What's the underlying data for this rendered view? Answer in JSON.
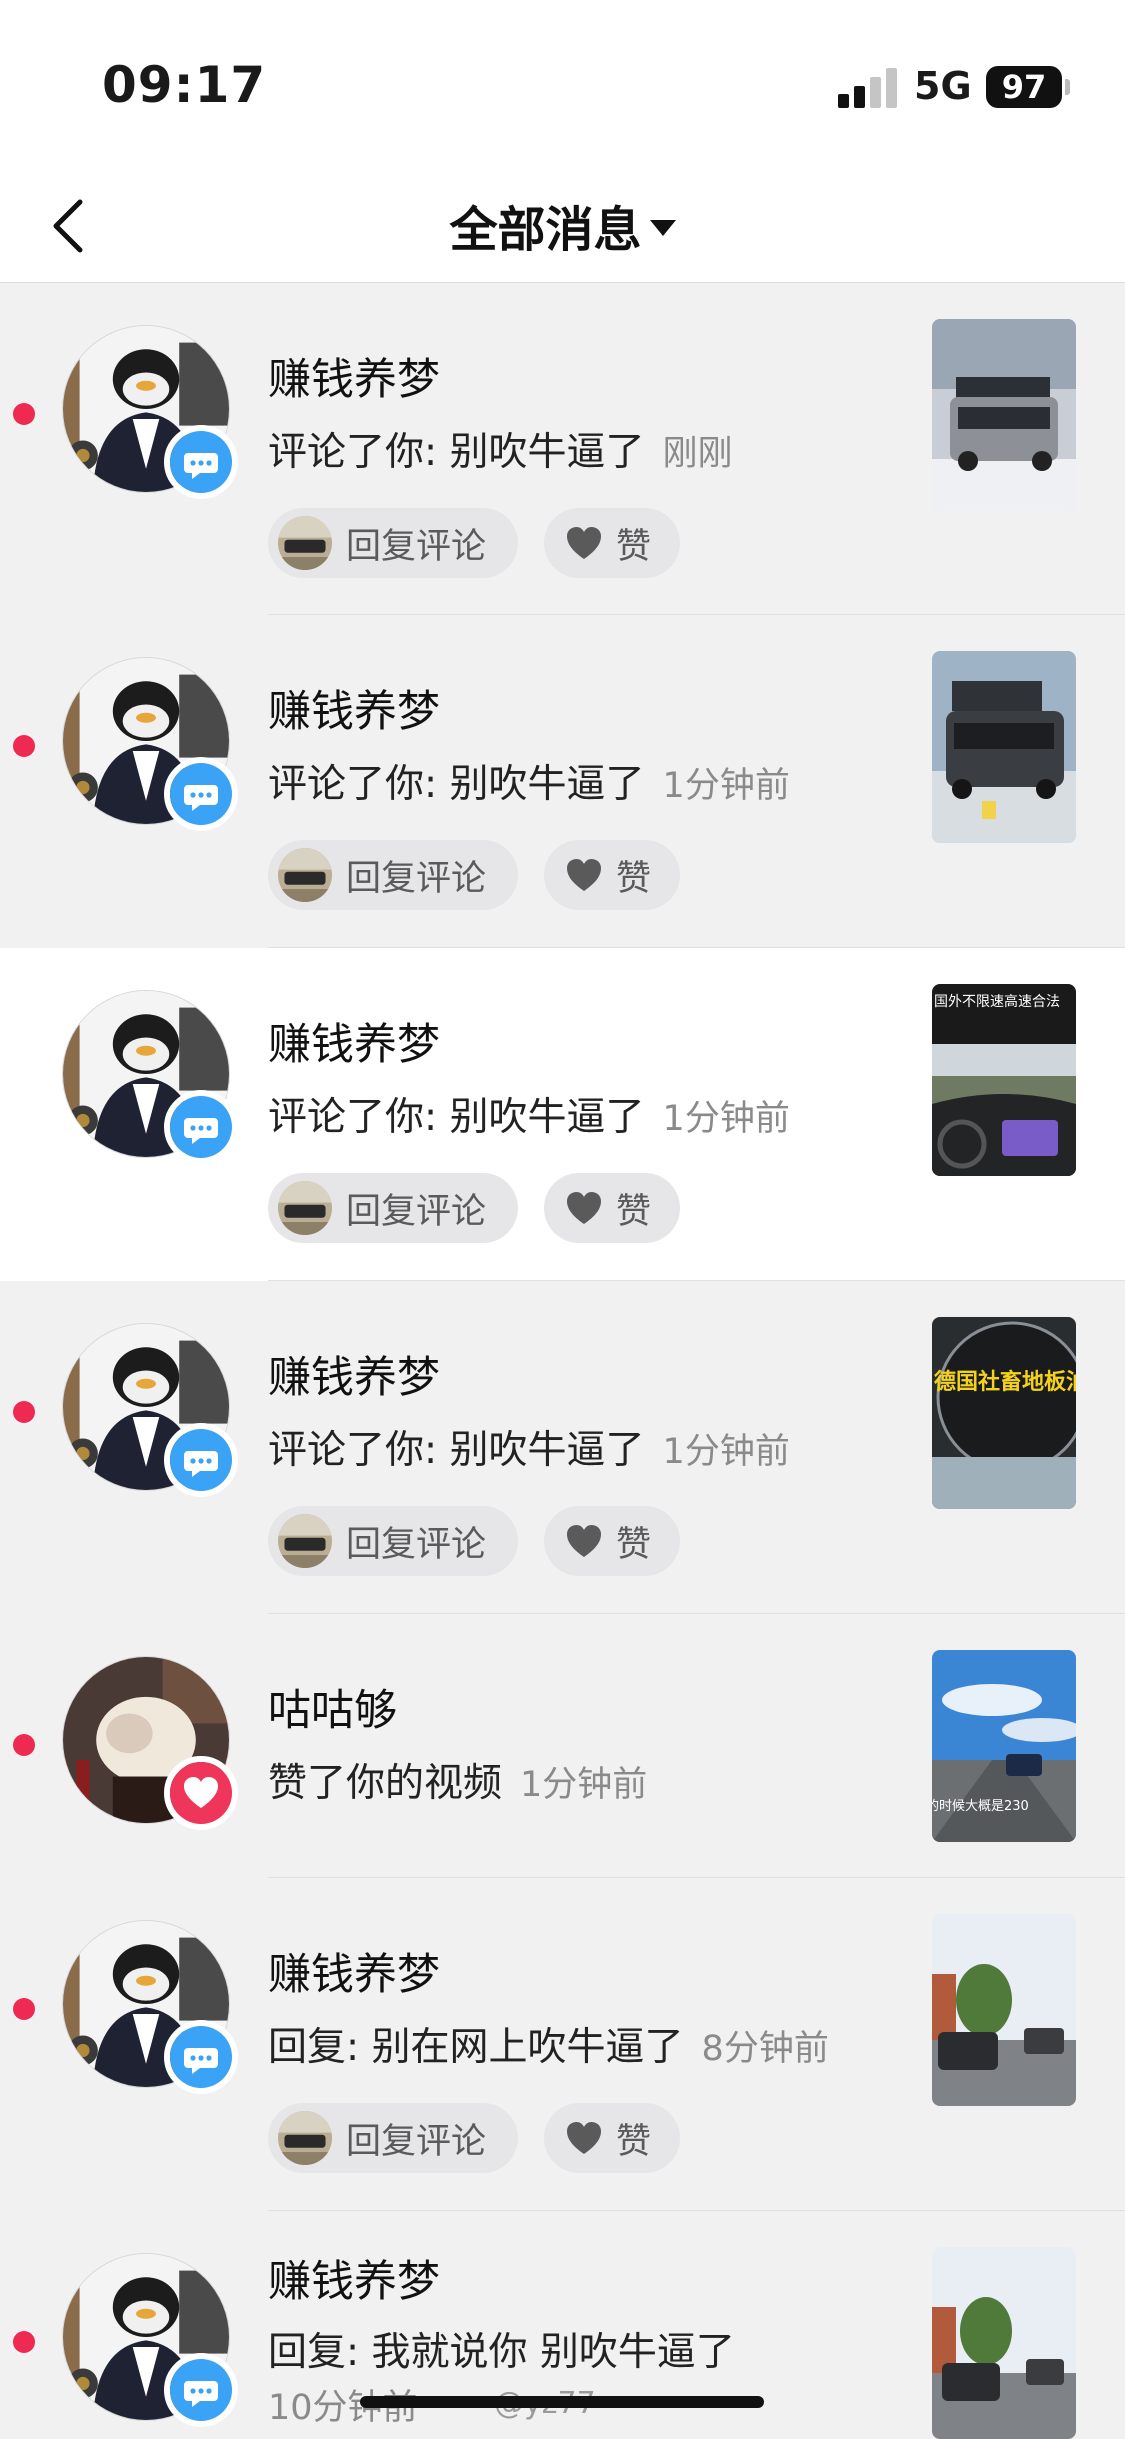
{
  "status_bar": {
    "time": "09:17",
    "network": "5G",
    "battery": "97"
  },
  "header": {
    "title": "全部消息"
  },
  "buttons": {
    "reply": "回复评论",
    "like": "赞"
  },
  "messages": [
    {
      "name": "赚钱养梦",
      "action": "评论了你: 别吹牛逼了",
      "time": "刚刚",
      "unread": true,
      "type": "comment"
    },
    {
      "name": "赚钱养梦",
      "action": "评论了你: 别吹牛逼了",
      "time": "1分钟前",
      "unread": true,
      "type": "comment"
    },
    {
      "name": "赚钱养梦",
      "action": "评论了你: 别吹牛逼了",
      "time": "1分钟前",
      "unread": false,
      "type": "comment",
      "thumb_text": "国外不限速高速合法"
    },
    {
      "name": "赚钱养梦",
      "action": "评论了你: 别吹牛逼了",
      "time": "1分钟前",
      "unread": true,
      "type": "comment",
      "thumb_text": "德国社畜地板油通勤日"
    },
    {
      "name": "咕咕够",
      "action": "赞了你的视频",
      "time": "1分钟前",
      "unread": true,
      "type": "like",
      "thumb_text": "的时候大概是230"
    },
    {
      "name": "赚钱养梦",
      "action": "回复: 别在网上吹牛逼了",
      "time": "8分钟前",
      "unread": true,
      "type": "comment"
    },
    {
      "name": "赚钱养梦",
      "action": "回复: 我就说你 别吹牛逼了",
      "time": "10分钟前",
      "unread": true,
      "type": "comment"
    }
  ],
  "watermark": "@yz77",
  "colors": {
    "unread_dot": "#ee2a52",
    "comment_badge": "#3aa3f5",
    "like_badge": "#f0355a"
  }
}
